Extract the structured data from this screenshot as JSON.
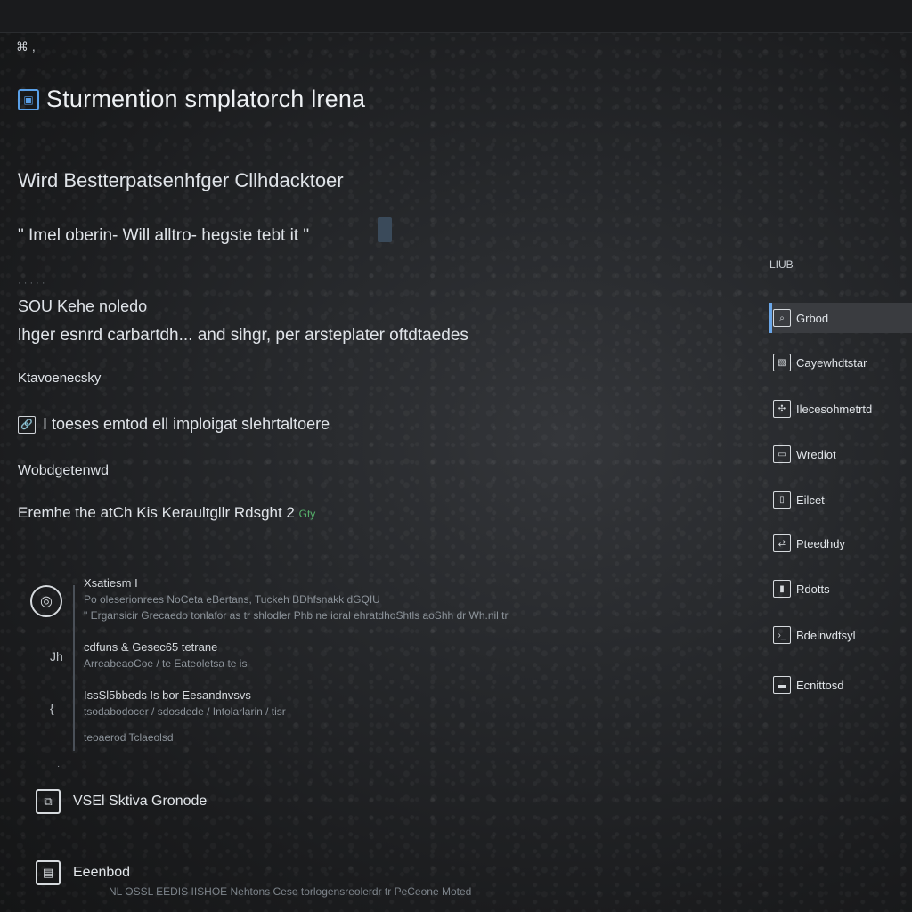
{
  "header": {
    "glyph": "⌘ ,",
    "app_icon": "app-window-icon",
    "title": "Sturmention smplatorch lrena"
  },
  "content": {
    "line1": "Wird Bestterpatsenhfger Cllhdacktoer",
    "line2": "\" Imel oberin- Will alltro- hegste tebt it \"",
    "line3_faint": "· · · · ·",
    "line3": "SOU Kehe noledo",
    "line4": "lhger esnrd carbartdh... and sihgr, per arsteplater oftdtaedes",
    "line5": "Ktavoenecsky",
    "line6_icon": "link-icon",
    "line6": "I toeses emtod ell imploigat slehrtaltoere",
    "line7": "Wobdgetenwd",
    "line8": "Eremhe the atCh Kis Keraultgllr Rdsght 2",
    "line8_accent": "Gty"
  },
  "activity": {
    "author_icon": "github-icon",
    "items": [
      {
        "side": "",
        "head": "Xsatiesm I",
        "sub": "Po oleserionrees NoCeta eBertans, Tuckeh BDhfsnakk dGQIU",
        "sub2": "\" Ergansicir Grecaedo tonlafor as tr shlodler Phb ne ioral ehratdhoShtls aoShh dr Wh.nil tr"
      },
      {
        "side": "Jh",
        "head": "cdfuns & Gesec65 tetrane",
        "sub": "ArreabeaoCoe / te Eateoletsa te is"
      },
      {
        "side": "{",
        "head": "IssSl5bbeds Is bor Eesandnvsvs",
        "sub": "tsodabodocer / sdosdede / Intolarlarin / tisr"
      },
      {
        "side": "",
        "head": "",
        "sub": "teoaerod Tclaeolsd"
      }
    ],
    "dot": "·"
  },
  "bottom": {
    "items": [
      {
        "icon": "window-icon",
        "label": "VSEl Sktiva Gronode"
      },
      {
        "icon": "document-icon",
        "label": "Eeenbod"
      }
    ],
    "footer": "NL OSSL EEDIS IISHOE Nehtons Cese torlogensreolerdr tr PeCeone Moted"
  },
  "right_panel": {
    "header": "LIUB",
    "items": [
      {
        "icon": "search-icon",
        "label": "Grbod",
        "active": true
      },
      {
        "icon": "image-icon",
        "label": "Cayewhdtstar",
        "active": false
      },
      {
        "icon": "puzzle-icon",
        "label": "Ilecesohmetrtd",
        "active": false
      },
      {
        "icon": "window-icon",
        "label": "Wrediot",
        "active": false
      },
      {
        "icon": "file-icon",
        "label": "Eilcet",
        "active": false
      },
      {
        "icon": "share-icon",
        "label": "Pteedhdy",
        "active": false
      },
      {
        "icon": "book-icon",
        "label": "Rdotts",
        "active": false
      },
      {
        "icon": "terminal-icon",
        "label": "Bdelnvdtsyl",
        "active": false
      },
      {
        "icon": "card-icon",
        "label": "Ecnittosd",
        "active": false
      }
    ]
  },
  "colors": {
    "background": "#18191b",
    "accent": "#5aa0e8",
    "green_accent": "#55b06a"
  }
}
